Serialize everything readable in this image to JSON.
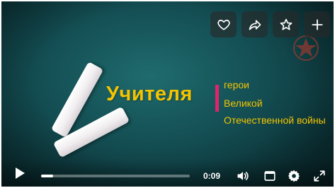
{
  "title": {
    "main": "Учителя",
    "line1": "герои",
    "line2": "Великой",
    "line3": "Отечественной войны"
  },
  "actions": [
    {
      "icon": "heart-icon"
    },
    {
      "icon": "share-icon"
    },
    {
      "icon": "star-icon"
    },
    {
      "icon": "plus-icon"
    }
  ],
  "player": {
    "time": "0:09",
    "progress": 0.08
  },
  "colors": {
    "title": "#f4c400",
    "divider": "#e0246b",
    "board": "#134d52"
  }
}
